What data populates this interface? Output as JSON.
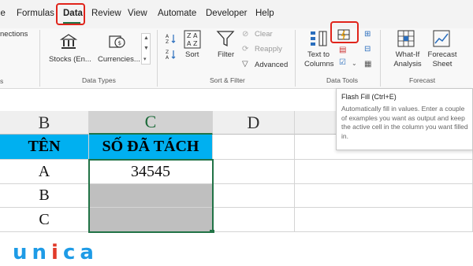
{
  "menu": {
    "tabs": [
      "File",
      "Formulas",
      "Data",
      "Review",
      "View",
      "Automate",
      "Developer",
      "Help"
    ],
    "partial_left": "File",
    "active": "Data"
  },
  "ribbon": {
    "connections_partial": "nections",
    "data_types": {
      "stocks": "Stocks (En...",
      "currencies": "Currencies...",
      "group_label": "Data Types"
    },
    "sort_filter": {
      "sort": "Sort",
      "filter": "Filter",
      "clear": "Clear",
      "reapply": "Reapply",
      "advanced": "Advanced",
      "group_label": "Sort & Filter"
    },
    "data_tools": {
      "text_to_columns": "Text to Columns",
      "group_label": "Data Tools"
    },
    "forecast": {
      "what_if": "What-If Analysis",
      "forecast_sheet": "Forecast Sheet",
      "group_label": "Forecast"
    },
    "left_group_partial": "s"
  },
  "tooltip": {
    "title": "Flash Fill (Ctrl+E)",
    "body": "Automatically fill in values. Enter a couple of examples you want as output and keep the active cell in the column you want filled in."
  },
  "sheet": {
    "columns": [
      "B",
      "C",
      "D"
    ],
    "header_row": [
      "TÊN",
      "SỐ ĐÃ TÁCH"
    ],
    "rows": [
      [
        "A",
        "34545"
      ],
      [
        "B",
        ""
      ],
      [
        "C",
        ""
      ]
    ]
  },
  "logo": {
    "text": "unica"
  },
  "colors": {
    "accent_red": "#e0241b",
    "header_fill": "#00b0f0",
    "empty_fill": "#bfbfbf",
    "logo_blue": "#1e9be6",
    "logo_red": "#e13a2a"
  }
}
